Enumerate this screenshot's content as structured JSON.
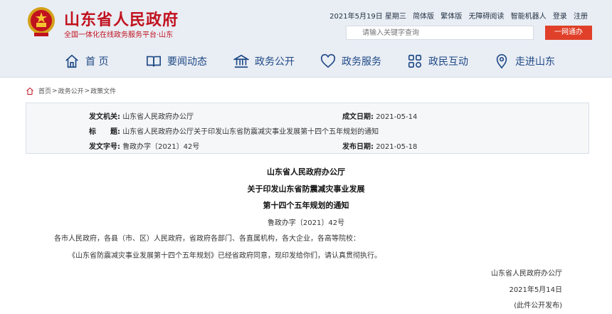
{
  "header": {
    "site_title": "山东省人民政府",
    "site_subtitle": "全国一体化在线政务服务平台·山东",
    "date": "2021年5月19日 星期三",
    "links": [
      "简体版",
      "繁体版",
      "无障碍阅读",
      "智能机器人",
      "登录",
      "注册"
    ],
    "search_placeholder": "请输入关键字查询",
    "search_button": "一网通办"
  },
  "nav": {
    "items": [
      {
        "label": "首 页",
        "icon": "home-icon"
      },
      {
        "label": "要闻动态",
        "icon": "book-icon"
      },
      {
        "label": "政务公开",
        "icon": "government-building-icon"
      },
      {
        "label": "政务服务",
        "icon": "heart-icon"
      },
      {
        "label": "政民互动",
        "icon": "grid-icon"
      },
      {
        "label": "走进山东",
        "icon": "location-pin-icon"
      }
    ]
  },
  "breadcrumb": {
    "items": [
      "首页",
      "政务公开",
      "政策文件"
    ],
    "separator": ">"
  },
  "info": {
    "issuer_label": "发文机关:",
    "issuer": "山东省人民政府办公厅",
    "date_label": "成文日期:",
    "date": "2021-05-14",
    "title_label": "标　　题:",
    "title": "山东省人民政府办公厅关于印发山东省防震减灾事业发展第十四个五年规划的通知",
    "docno_label": "发文字号:",
    "docno": "鲁政办字〔2021〕42号",
    "pubdate_label": "发布日期:",
    "pubdate": "2021-05-18"
  },
  "document": {
    "heading_1": "山东省人民政府办公厅",
    "heading_2": "关于印发山东省防震减灾事业发展",
    "heading_3": "第十四个五年规划的通知",
    "doc_number": "鲁政办字〔2021〕42号",
    "recipients": "各市人民政府，各县（市、区）人民政府，省政府各部门、各直属机构，各大企业，各高等院校：",
    "body": "《山东省防震减灾事业发展第十四个五年规划》已经省政府同意，现印发给你们，请认真贯彻执行。",
    "signature": "山东省人民政府办公厅",
    "sign_date": "2021年5月14日",
    "note": "(此件公开发布)"
  }
}
